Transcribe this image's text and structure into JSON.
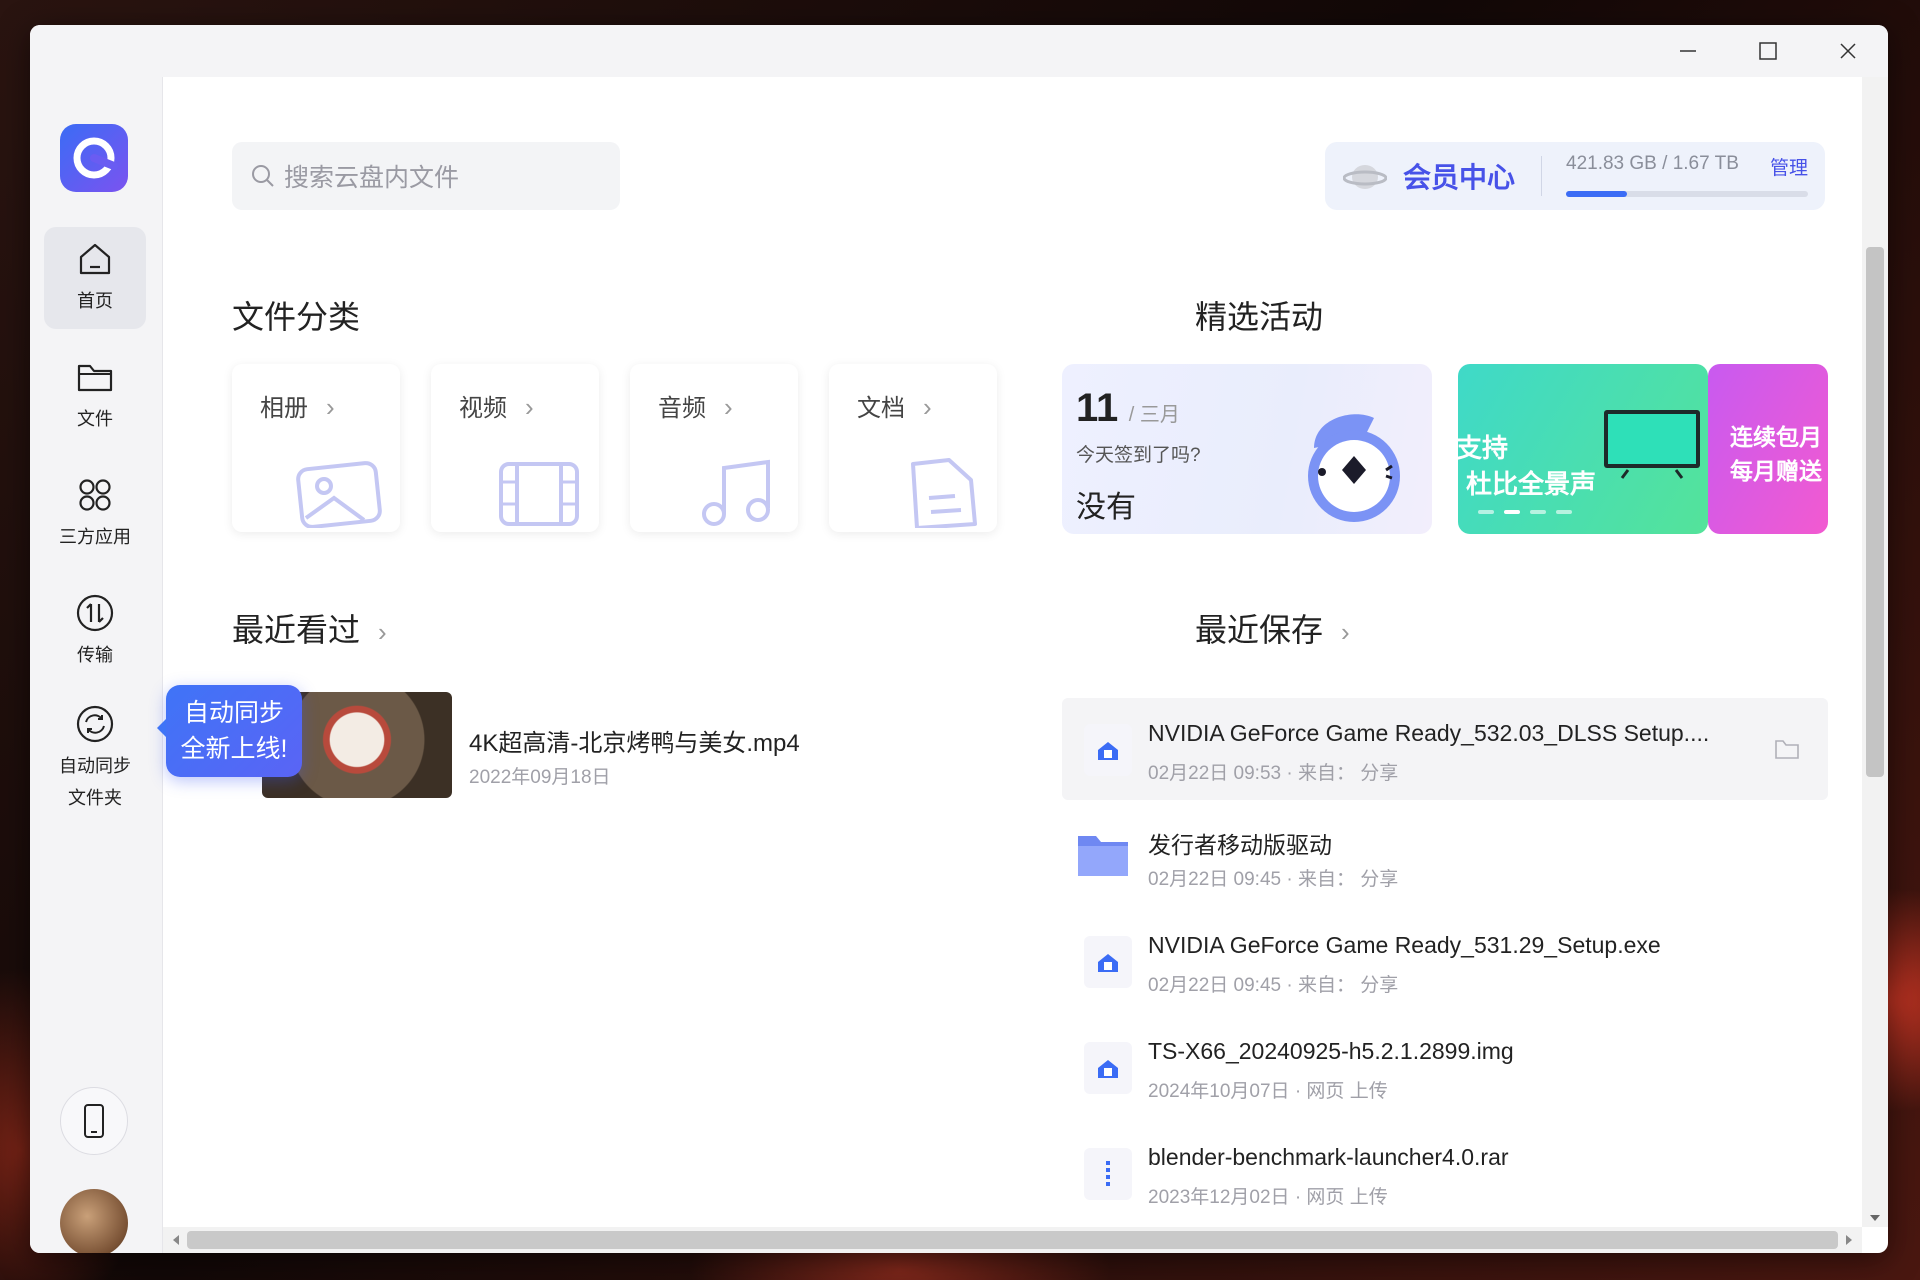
{
  "search": {
    "placeholder": "搜索云盘内文件"
  },
  "vip": {
    "label": "会员中心",
    "storage": "421.83 GB / 1.67 TB",
    "storage_fraction": 0.25,
    "manage": "管理"
  },
  "sidebar": {
    "items": [
      {
        "label": "首页",
        "icon": "home-icon"
      },
      {
        "label": "文件",
        "icon": "folder-icon"
      },
      {
        "label": "三方应用",
        "icon": "apps-icon"
      },
      {
        "label": "传输",
        "icon": "transfer-icon"
      },
      {
        "label": "自动同步\n文件夹",
        "line1": "自动同步",
        "line2": "文件夹",
        "icon": "sync-icon"
      }
    ]
  },
  "tooltip": {
    "line1": "自动同步",
    "line2": "全新上线!"
  },
  "categories": {
    "title": "文件分类",
    "items": [
      {
        "label": "相册",
        "icon": "image-icon"
      },
      {
        "label": "视频",
        "icon": "film-icon"
      },
      {
        "label": "音频",
        "icon": "music-icon"
      },
      {
        "label": "文档",
        "icon": "document-icon"
      }
    ]
  },
  "activities": {
    "title": "精选活动",
    "checkin": {
      "day": "11",
      "month": "/ 三月",
      "question": "今天签到了吗?",
      "answer": "没有"
    },
    "banner1": {
      "line1": "支持",
      "line2": "杜比全景声"
    },
    "banner2": {
      "line1": "连续包月",
      "line2": "每月赠送"
    }
  },
  "recent_viewed": {
    "title": "最近看过",
    "items": [
      {
        "name": "4K超高清-北京烤鸭与美女.mp4",
        "date": "2022年09月18日"
      }
    ]
  },
  "recent_saved": {
    "title": "最近保存",
    "items": [
      {
        "name": "NVIDIA GeForce Game Ready_532.03_DLSS Setup....",
        "meta": "02月22日 09:53 · 来自： 分享",
        "type": "exe"
      },
      {
        "name": "发行者移动版驱动",
        "meta": "02月22日 09:45 · 来自： 分享",
        "type": "folder"
      },
      {
        "name": "NVIDIA GeForce Game Ready_531.29_Setup.exe",
        "meta": "02月22日 09:45 · 来自： 分享",
        "type": "exe"
      },
      {
        "name": "TS-X66_20240925-h5.2.1.2899.img",
        "meta": "2024年10月07日 · 网页 上传",
        "type": "exe"
      },
      {
        "name": "blender-benchmark-launcher4.0.rar",
        "meta": "2023年12月02日 · 网页 上传",
        "type": "zip"
      }
    ]
  }
}
